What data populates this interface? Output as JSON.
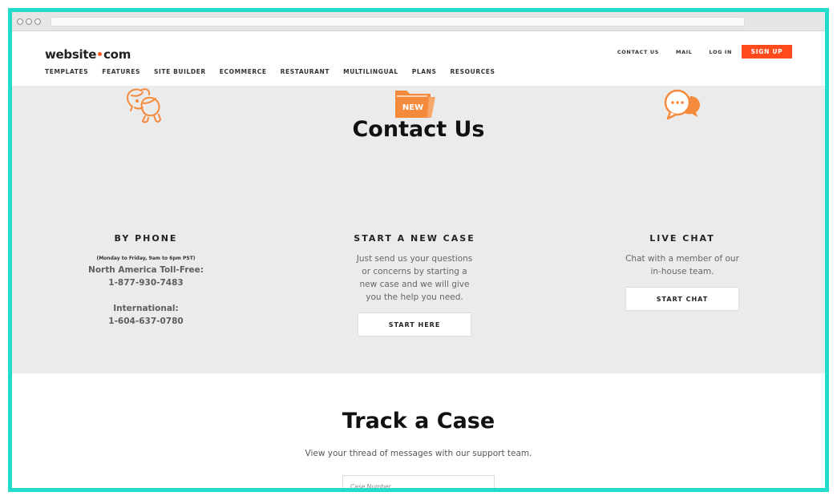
{
  "header": {
    "logo_text_left": "website",
    "logo_text_right": "com",
    "main_nav": [
      "TEMPLATES",
      "FEATURES",
      "SITE BUILDER",
      "ECOMMERCE",
      "RESTAURANT",
      "MULTILINGUAL",
      "PLANS",
      "RESOURCES"
    ],
    "util_nav": [
      "CONTACT US",
      "MAIL",
      "LOG IN"
    ],
    "signup_label": "SIGN UP"
  },
  "contact": {
    "title": "Contact Us",
    "phone": {
      "heading": "BY PHONE",
      "hours": "(Monday to Friday, 9am to 6pm PST)",
      "na_label": "North America Toll-Free:",
      "na_number": "1-877-930-7483",
      "intl_label": "International:",
      "intl_number": "1-604-637-0780",
      "icon": "two-people-icon"
    },
    "new_case": {
      "heading": "START A NEW CASE",
      "body": [
        "Just send us your questions",
        "or concerns by starting a",
        "new case and we will give",
        "you the help you need."
      ],
      "button": "START HERE",
      "icon": "new-folder-icon",
      "icon_text": "NEW"
    },
    "live_chat": {
      "heading": "LIVE CHAT",
      "body": [
        "Chat with a member of our",
        "in-house team."
      ],
      "button": "START CHAT",
      "icon": "chat-bubbles-icon"
    }
  },
  "track": {
    "title": "Track a Case",
    "subtitle": "View your thread of messages with our support team.",
    "input_placeholder": "Case Number"
  },
  "colors": {
    "accent": "#ff4a1c",
    "icon_orange": "#f68a3c",
    "frame": "#22dccb",
    "section_bg": "#ebebeb"
  }
}
